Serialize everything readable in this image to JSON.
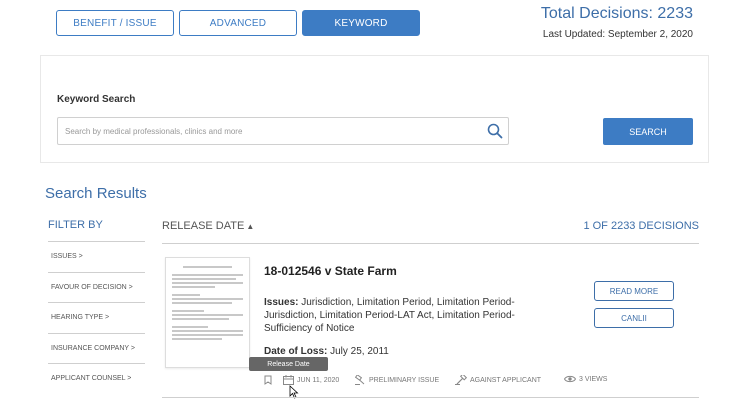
{
  "tabs": [
    {
      "label": "BENEFIT / ISSUE",
      "active": false
    },
    {
      "label": "ADVANCED",
      "active": false
    },
    {
      "label": "KEYWORD",
      "active": true
    }
  ],
  "totals": {
    "total": "Total Decisions: 2233",
    "updated": "Last Updated: September 2, 2020"
  },
  "search": {
    "label": "Keyword Search",
    "placeholder": "Search by medical professionals, clinics and more",
    "button": "SEARCH"
  },
  "results": {
    "title": "Search Results",
    "filter_title": "FILTER BY",
    "filters": [
      "ISSUES >",
      "FAVOUR OF DECISION >",
      "HEARING TYPE >",
      "INSURANCE COMPANY >",
      "APPLICANT COUNSEL >"
    ],
    "sort_label": "RELEASE DATE",
    "count": "1 OF 2233 DECISIONS"
  },
  "case": {
    "title": "18-012546 v State Farm",
    "issues_label": "Issues:",
    "issues_text": "Jurisdiction, Limitation Period, Limitation Period-Jurisdiction, Limitation Period-LAT Act, Limitation Period-Sufficiency of Notice",
    "dol_label": "Date of Loss:",
    "dol_value": "July 25, 2011",
    "read_more": "READ MORE",
    "canlii": "CANLII",
    "date": "JUN 11, 2020",
    "type": "PRELIMINARY ISSUE",
    "favour": "AGAINST APPLICANT",
    "views": "3 VIEWS",
    "tooltip": "Release Date"
  },
  "colors": {
    "accent": "#3d7cc4",
    "heading": "#3d6ea8"
  }
}
